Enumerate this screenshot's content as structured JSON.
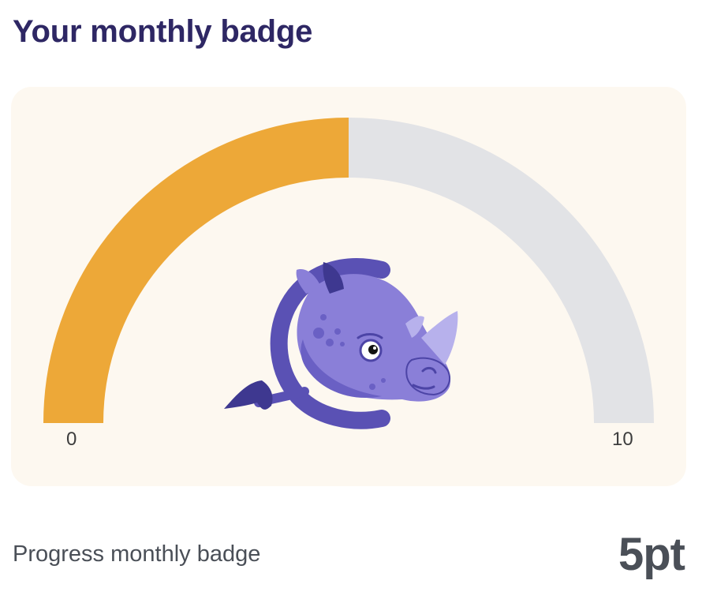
{
  "header": {
    "title": "Your monthly badge"
  },
  "gauge": {
    "min_label": "0",
    "max_label": "10",
    "min": 0,
    "max": 10,
    "value": 5,
    "colors": {
      "filled": "#eda838",
      "track": "#e2e3e6",
      "card_background": "#fdf8f0"
    },
    "mascot_icon": "rhino-mascot-icon"
  },
  "footer": {
    "label": "Progress monthly badge",
    "value_text": "5pt"
  }
}
